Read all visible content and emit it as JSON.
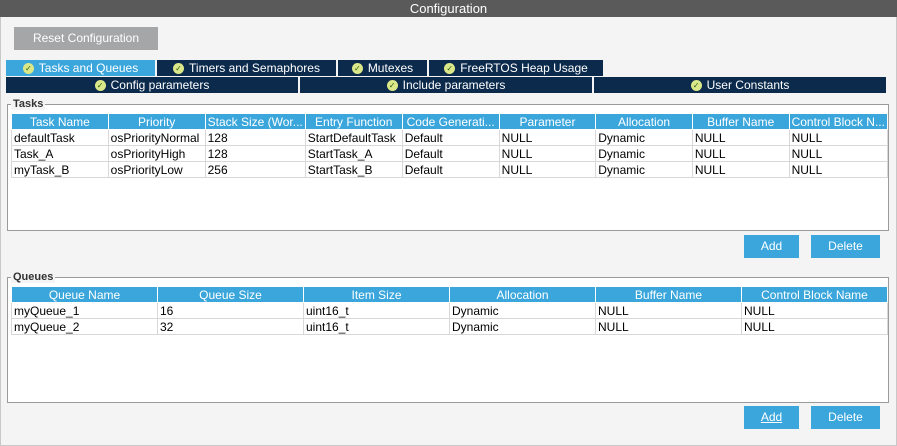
{
  "window": {
    "title": "Configuration"
  },
  "toolbar": {
    "reset_label": "Reset Configuration"
  },
  "tabs_row1": [
    {
      "label": "Tasks and Queues",
      "active": true
    },
    {
      "label": "Timers and Semaphores",
      "active": false
    },
    {
      "label": "Mutexes",
      "active": false
    },
    {
      "label": "FreeRTOS Heap Usage",
      "active": false
    }
  ],
  "tabs_row2": [
    {
      "label": "Config parameters"
    },
    {
      "label": "Include parameters"
    },
    {
      "label": "User Constants"
    }
  ],
  "tasks": {
    "legend": "Tasks",
    "columns": [
      "Task Name",
      "Priority",
      "Stack Size (Wor...",
      "Entry Function",
      "Code Generati...",
      "Parameter",
      "Allocation",
      "Buffer Name",
      "Control Block N..."
    ],
    "rows": [
      [
        "defaultTask",
        "osPriorityNormal",
        "128",
        "StartDefaultTask",
        "Default",
        "NULL",
        "Dynamic",
        "NULL",
        "NULL"
      ],
      [
        "Task_A",
        "osPriorityHigh",
        "128",
        "StartTask_A",
        "Default",
        "NULL",
        "Dynamic",
        "NULL",
        "NULL"
      ],
      [
        "myTask_B",
        "osPriorityLow",
        "256",
        "StartTask_B",
        "Default",
        "NULL",
        "Dynamic",
        "NULL",
        "NULL"
      ]
    ],
    "add_label": "Add",
    "delete_label": "Delete"
  },
  "queues": {
    "legend": "Queues",
    "columns": [
      "Queue Name",
      "Queue Size",
      "Item Size",
      "Allocation",
      "Buffer Name",
      "Control Block Name"
    ],
    "rows": [
      [
        "myQueue_1",
        "16",
        "uint16_t",
        "Dynamic",
        "NULL",
        "NULL"
      ],
      [
        "myQueue_2",
        "32",
        "uint16_t",
        "Dynamic",
        "NULL",
        "NULL"
      ]
    ],
    "add_label": "Add",
    "delete_label": "Delete"
  },
  "colors": {
    "header": "#3aa6dc",
    "tab_dark": "#0b2a4c",
    "title_bar": "#5a5a5a",
    "reset_button": "#a4a6a8"
  }
}
